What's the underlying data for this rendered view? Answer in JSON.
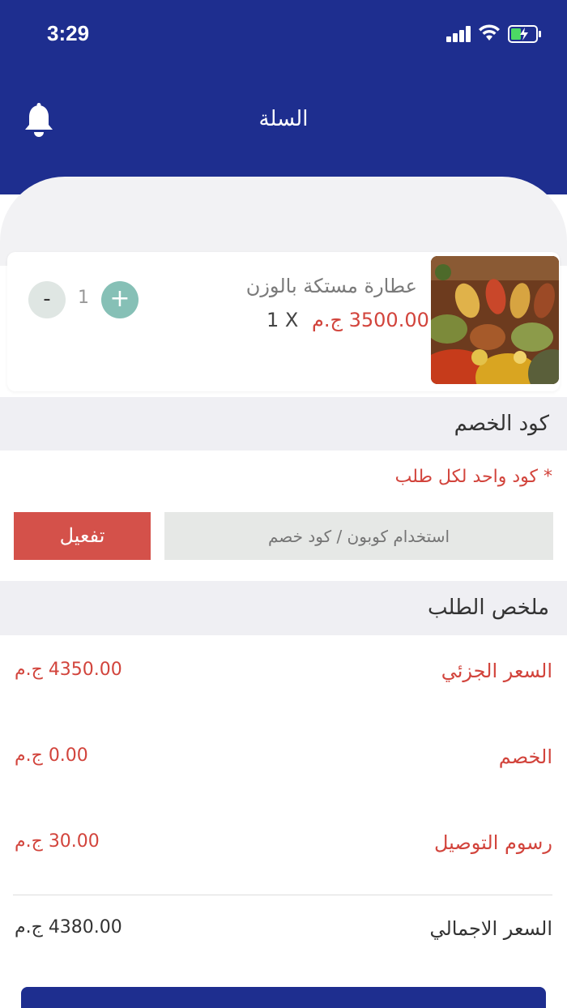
{
  "status_bar": {
    "time": "3:29"
  },
  "header": {
    "title": "السلة"
  },
  "cart": {
    "item": {
      "name": "عطارة مستكة بالوزن",
      "price": "3500.00 ج.م",
      "qty_text": "1 X",
      "quantity": "1",
      "minus_label": "-",
      "plus_label": "+"
    }
  },
  "discount": {
    "title": "كود الخصم",
    "note": "* كود واحد لكل طلب",
    "placeholder": "استخدام كوبون / كود خصم",
    "activate_label": "تفعيل"
  },
  "summary": {
    "title": "ملخص الطلب",
    "rows": [
      {
        "label": "السعر الجزئي",
        "value": "4350.00 ج.م"
      },
      {
        "label": "الخصم",
        "value": "0.00 ج.م"
      },
      {
        "label": "رسوم التوصيل",
        "value": "30.00 ج.م"
      }
    ],
    "total": {
      "label": "السعر الاجمالي",
      "value": "4380.00 ج.م"
    }
  },
  "colors": {
    "primary": "#1e2e8f",
    "accent_red": "#d2443c",
    "plus_green": "#86c0b6"
  }
}
